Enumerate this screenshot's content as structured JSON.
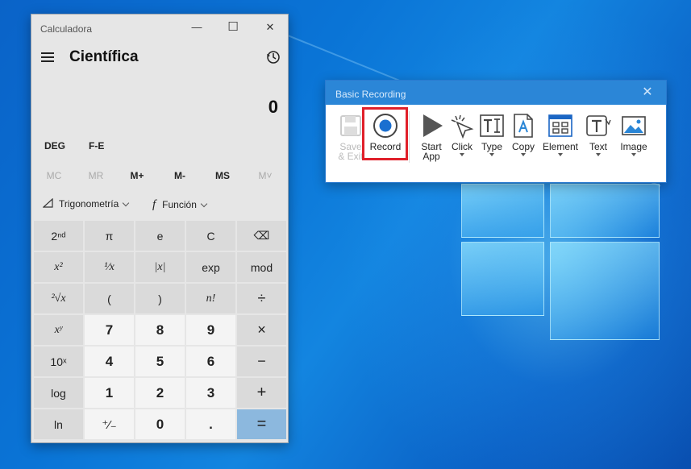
{
  "calculator": {
    "title": "Calculadora",
    "mode_title": "Científica",
    "display_value": "0",
    "angle_modes": [
      "DEG",
      "F-E"
    ],
    "memory_buttons": [
      {
        "label": "MC",
        "enabled": false
      },
      {
        "label": "MR",
        "enabled": false
      },
      {
        "label": "M+",
        "enabled": true
      },
      {
        "label": "M-",
        "enabled": true
      },
      {
        "label": "MS",
        "enabled": true
      },
      {
        "label": "M˅",
        "enabled": false
      }
    ],
    "trig_label": "Trigonometría",
    "func_label": "Función",
    "func_symbol": "f",
    "keys": [
      [
        "2ⁿᵈ",
        "π",
        "e",
        "C",
        "⌫"
      ],
      [
        "x²",
        "¹⁄x",
        "|x|",
        "exp",
        "mod"
      ],
      [
        "²√x",
        "(",
        ")",
        "n!",
        "÷"
      ],
      [
        "xʸ",
        "7",
        "8",
        "9",
        "×"
      ],
      [
        "10ˣ",
        "4",
        "5",
        "6",
        "−"
      ],
      [
        "log",
        "1",
        "2",
        "3",
        "+"
      ],
      [
        "ln",
        "⁺⁄₋",
        "0",
        ".",
        "="
      ]
    ],
    "window_controls": {
      "minimize": "—",
      "maximize": "☐",
      "close": "✕"
    }
  },
  "recorder": {
    "title": "Basic Recording",
    "close": "✕",
    "tools": [
      {
        "label": "Save\n& Exit",
        "icon": "save-icon",
        "enabled": false
      },
      {
        "label": "Record",
        "icon": "record-icon",
        "enabled": true
      },
      {
        "label": "Start\nApp",
        "icon": "play-icon",
        "enabled": true
      },
      {
        "label": "Click",
        "icon": "cursor-click-icon",
        "enabled": true
      },
      {
        "label": "Type",
        "icon": "text-type-icon",
        "enabled": true
      },
      {
        "label": "Copy",
        "icon": "copy-icon",
        "enabled": true
      },
      {
        "label": "Element",
        "icon": "element-icon",
        "enabled": true
      },
      {
        "label": "Text",
        "icon": "text-icon",
        "enabled": true
      },
      {
        "label": "Image",
        "icon": "image-icon",
        "enabled": true
      }
    ]
  }
}
